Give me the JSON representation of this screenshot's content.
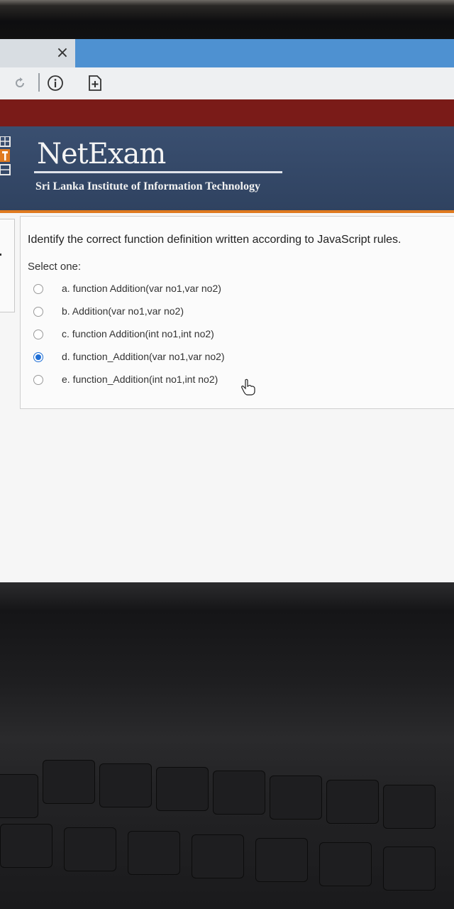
{
  "browser": {
    "close_glyph": "×"
  },
  "site": {
    "brand": "NetExam",
    "subtitle": "Sri Lanka Institute of Information Technology",
    "colors": {
      "header": "#34496a",
      "top_bar": "#7a1b18",
      "accent": "#e07a1f",
      "radio_selected": "#1f6fd6"
    }
  },
  "question": {
    "text": "Identify the correct function definition written according to JavaScript rules.",
    "select_label": "Select one:",
    "options": [
      {
        "label": "a. function Addition(var no1,var no2)",
        "selected": false
      },
      {
        "label": "b. Addition(var no1,var no2)",
        "selected": false
      },
      {
        "label": "c. function Addition(int no1,int no2)",
        "selected": false
      },
      {
        "label": "d. function_Addition(var no1,var no2)",
        "selected": true
      },
      {
        "label": "e. function_Addition(int no1,int no2)",
        "selected": false
      }
    ]
  }
}
